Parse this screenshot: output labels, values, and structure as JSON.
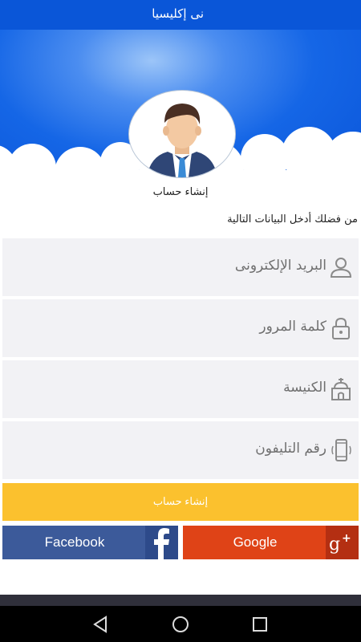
{
  "app": {
    "title": "نى إكليسيا"
  },
  "header": {
    "subtitle": "إنشاء حساب",
    "instructions": "من فضلك أدخل البيانات التالية"
  },
  "form": {
    "email": {
      "label": "البريد الإلكترونى",
      "icon": "user-icon"
    },
    "password": {
      "label": "كلمة المرور",
      "icon": "lock-icon"
    },
    "church": {
      "label": "الكنيسة",
      "icon": "church-icon"
    },
    "phone": {
      "label": "رقم التليفون",
      "icon": "phone-icon"
    },
    "submit_label": "إنشاء حساب"
  },
  "social": {
    "facebook_label": "Facebook",
    "google_label": "Google"
  },
  "colors": {
    "appbar": "#0a56d8",
    "submit": "#fbc12e",
    "facebook": "#3c5a9a",
    "google": "#df4317"
  }
}
